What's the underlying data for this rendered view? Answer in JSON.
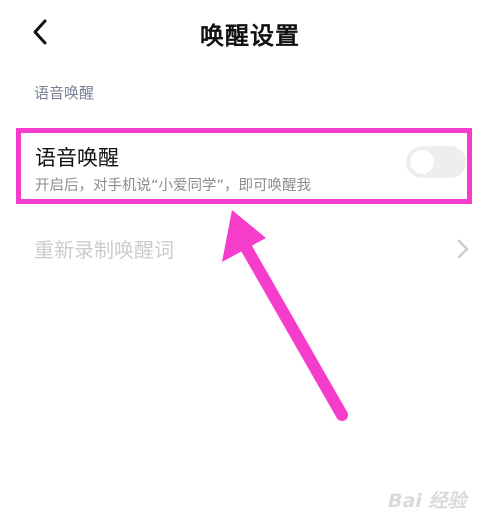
{
  "header": {
    "title": "唤醒设置",
    "back_icon": "chevron-left-icon"
  },
  "section": {
    "title": "语音唤醒"
  },
  "voice_wakeup": {
    "title": "语音唤醒",
    "description": "开启后，对手机说“小爱同学”，即可唤醒我",
    "toggle_on": false,
    "highlight_color": "#f53ccb"
  },
  "rerecord": {
    "label": "重新录制唤醒词",
    "chevron_icon": "chevron-right-icon"
  },
  "annotation": {
    "arrow_color": "#f53ccb"
  },
  "watermark": {
    "text": "Bai 经验"
  }
}
